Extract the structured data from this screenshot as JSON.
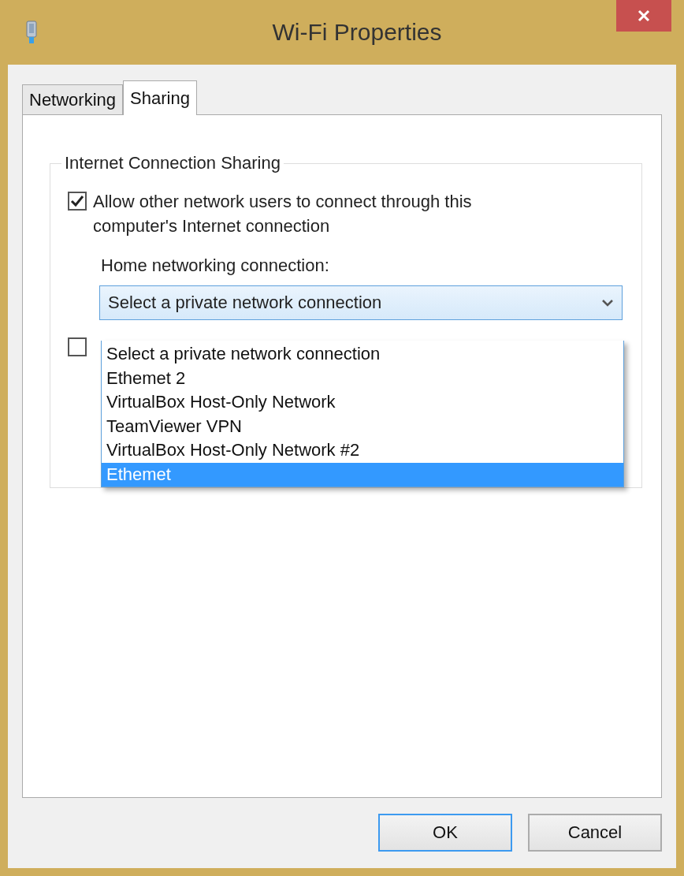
{
  "window": {
    "title": "Wi-Fi Properties"
  },
  "tabs": [
    {
      "label": "Networking",
      "selected": false
    },
    {
      "label": "Sharing",
      "selected": true
    }
  ],
  "group": {
    "title": "Internet Connection Sharing",
    "allow_checkbox": {
      "label": "Allow other network users to connect through this computer's Internet connection",
      "checked": true
    },
    "home_connection": {
      "label": "Home networking connection:",
      "value": "Select a private network connection",
      "expanded": true,
      "options": [
        {
          "label": "Select a private network connection",
          "highlighted": false
        },
        {
          "label": "Ethemet 2",
          "highlighted": false
        },
        {
          "label": "VirtualBox Host-Only Network",
          "highlighted": false
        },
        {
          "label": "TeamViewer VPN",
          "highlighted": false
        },
        {
          "label": "VirtualBox Host-Only Network #2",
          "highlighted": false
        },
        {
          "label": "Ethemet",
          "highlighted": true
        }
      ]
    },
    "second_checkbox": {
      "checked": false
    }
  },
  "buttons": [
    {
      "label": "OK",
      "focused": true
    },
    {
      "label": "Cancel",
      "focused": false
    }
  ]
}
